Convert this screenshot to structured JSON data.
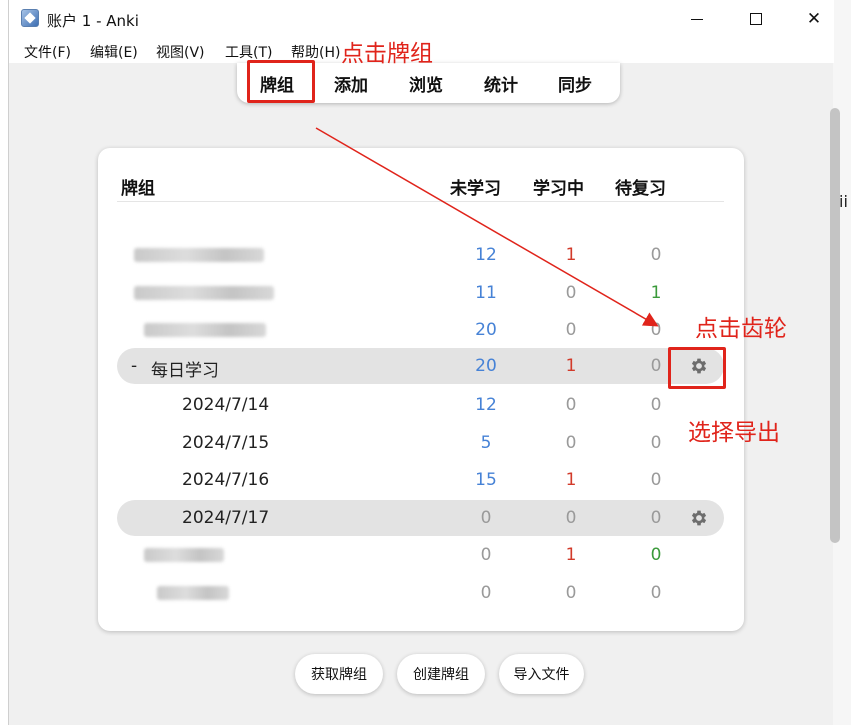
{
  "window": {
    "title": "账户 1 - Anki",
    "minimize_glyph": "—",
    "maximize_glyph": "☐",
    "close_glyph": "✕"
  },
  "menu": [
    "文件(F)",
    "编辑(E)",
    "视图(V)",
    "工具(T)",
    "帮助(H)"
  ],
  "tabs": [
    "牌组",
    "添加",
    "浏览",
    "统计",
    "同步"
  ],
  "table": {
    "headers": {
      "deck": "牌组",
      "new": "未学习",
      "learn": "学习中",
      "due": "待复习"
    },
    "rows": [
      {
        "name": "",
        "new": "12",
        "learn": "1",
        "due": "0"
      },
      {
        "name": "",
        "new": "11",
        "learn": "0",
        "due": "1"
      },
      {
        "name": "",
        "new": "20",
        "learn": "0",
        "due": "0"
      },
      {
        "name": "每日学习",
        "collapse": "-",
        "new": "20",
        "learn": "1",
        "due": "0"
      },
      {
        "name": "2024/7/14",
        "new": "12",
        "learn": "0",
        "due": "0"
      },
      {
        "name": "2024/7/15",
        "new": "5",
        "learn": "0",
        "due": "0"
      },
      {
        "name": "2024/7/16",
        "new": "15",
        "learn": "1",
        "due": "0"
      },
      {
        "name": "2024/7/17",
        "new": "0",
        "learn": "0",
        "due": "0"
      },
      {
        "name": "",
        "new": "0",
        "learn": "1",
        "due": "0"
      },
      {
        "name": "",
        "new": "0",
        "learn": "0",
        "due": "0"
      }
    ]
  },
  "buttons": {
    "get_shared": "获取牌组",
    "create_deck": "创建牌组",
    "import_file": "导入文件"
  },
  "annotations": {
    "click_decks": "点击牌组",
    "click_gear": "点击齿轮",
    "choose_export": "选择导出"
  },
  "colors": {
    "new": "#4682d6",
    "learn": "#d23a2a",
    "due_green": "#3a9a3a",
    "zero": "#9a9a9a",
    "annotation": "#e0241b"
  },
  "icons": {
    "gear": "gear-icon",
    "app": "anki-app-icon"
  }
}
